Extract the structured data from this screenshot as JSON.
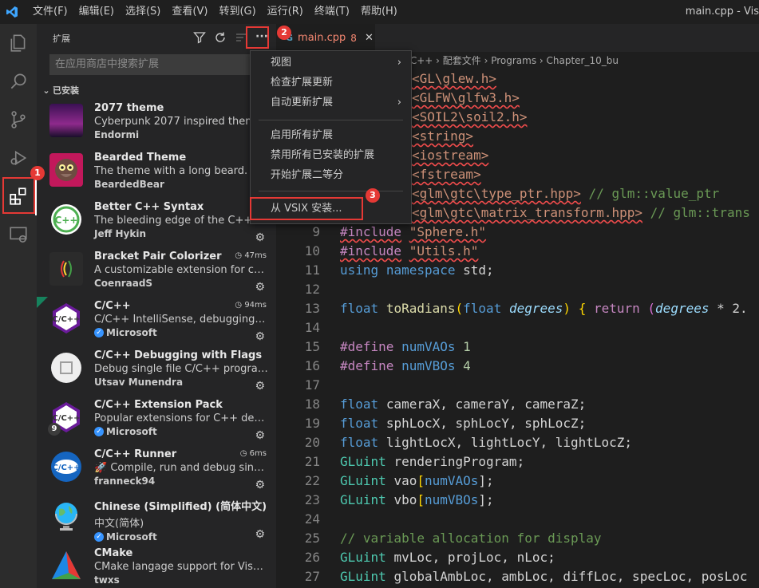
{
  "titlebar": {
    "menus": [
      "文件(F)",
      "编辑(E)",
      "选择(S)",
      "查看(V)",
      "转到(G)",
      "运行(R)",
      "终端(T)",
      "帮助(H)"
    ],
    "window_title": "main.cpp - Vis"
  },
  "sidebar": {
    "title": "扩展",
    "search_placeholder": "在应用商店中搜索扩展",
    "section_label": "已安装",
    "extensions": [
      {
        "name": "2077 theme",
        "desc": "Cyberpunk 2077 inspired theme",
        "publisher": "Endormi",
        "meta": "",
        "verified": false
      },
      {
        "name": "Bearded Theme",
        "desc": "The theme with a long beard.",
        "publisher": "BeardedBear",
        "meta": "",
        "verified": false
      },
      {
        "name": "Better C++ Syntax",
        "desc": "The bleeding edge of the C++ syntax",
        "publisher": "Jeff Hykin",
        "meta": "",
        "verified": false
      },
      {
        "name": "Bracket Pair Colorizer",
        "desc": "A customizable extension for coloriz...",
        "publisher": "CoenraadS",
        "meta": "47ms",
        "verified": false
      },
      {
        "name": "C/C++",
        "desc": "C/C++ IntelliSense, debugging, and...",
        "publisher": "Microsoft",
        "meta": "94ms",
        "verified": true
      },
      {
        "name": "C/C++ Debugging with Flags",
        "desc": "Debug single file C/C++ programs ...",
        "publisher": "Utsav Munendra",
        "meta": "",
        "verified": false
      },
      {
        "name": "C/C++ Extension Pack",
        "desc": "Popular extensions for C++ develop...",
        "publisher": "Microsoft",
        "meta": "",
        "verified": true,
        "count": "9"
      },
      {
        "name": "C/C++ Runner",
        "desc": "🚀 Compile, run and debug single ...",
        "publisher": "franneck94",
        "meta": "6ms",
        "verified": false
      },
      {
        "name": "Chinese (Simplified) (简体中文) La...",
        "desc": "中文(简体)",
        "publisher": "Microsoft",
        "meta": "",
        "verified": true
      },
      {
        "name": "CMake",
        "desc": "CMake langage support for Visual S...",
        "publisher": "twxs",
        "meta": "",
        "verified": false
      }
    ]
  },
  "tab": {
    "label": "main.cpp",
    "problems": "8",
    "close": "✕"
  },
  "breadcrumb": "机图形学编程 使用OpenGL和C++ › 配套文件 › Programs › Chapter_10_bu",
  "menu": {
    "items": [
      "视图",
      "检查扩展更新",
      "自动更新扩展",
      "启用所有扩展",
      "禁用所有已安装的扩展",
      "开始扩展二等分",
      "从 VSIX 安装..."
    ]
  },
  "annotations": [
    "1",
    "2",
    "3"
  ],
  "code": {
    "l1": "<GL\\glew.h>",
    "l2": "<GLFW\\glfw3.h>",
    "l3": "<SOIL2\\soil2.h>",
    "l4": "<string>",
    "l5": "<iostream>",
    "l6": "<fstream>",
    "l7a": "<glm\\gtc\\type_ptr.hpp>",
    "l7b": " // glm::value_ptr",
    "l8a": "<glm\\gtc\\matrix_transform.hpp>",
    "l8b": " // glm::trans",
    "l9a": "#include",
    "l9b": "\"Sphere.h\"",
    "l10a": "#include",
    "l10b": "\"Utils.h\"",
    "l11a": "using",
    "l11b": "namespace",
    "l11c": "std;",
    "l13a": "float",
    "l13b": "toRadians",
    "l13c": "(",
    "l13d": "float",
    "l13e": "degrees",
    "l13f": ")",
    "l13g": "{",
    "l13h": "return",
    "l13i": "(",
    "l13j": "degrees",
    "l13k": "* 2.",
    "l15a": "#define",
    "l15b": "numVAOs",
    "l15c": "1",
    "l16a": "#define",
    "l16b": "numVBOs",
    "l16c": "4",
    "l18a": "float",
    "l18b": "cameraX, cameraY, cameraZ;",
    "l19a": "float",
    "l19b": "sphLocX, sphLocY, sphLocZ;",
    "l20a": "float",
    "l20b": "lightLocX, lightLocY, lightLocZ;",
    "l21a": "GLuint",
    "l21b": "renderingProgram;",
    "l22a": "GLuint",
    "l22b": "vao",
    "l22c": "[",
    "l22d": "numVAOs",
    "l22e": "];",
    "l23a": "GLuint",
    "l23b": "vbo",
    "l23c": "[",
    "l23d": "numVBOs",
    "l23e": "];",
    "l25": "// variable allocation for display",
    "l26a": "GLuint",
    "l26b": "mvLoc, projLoc, nLoc;",
    "l27a": "GLuint",
    "l27b": "globalAmbLoc, ambLoc, diffLoc, specLoc, posLoc"
  },
  "line_numbers": [
    "9",
    "10",
    "11",
    "12",
    "13",
    "14",
    "15",
    "16",
    "17",
    "18",
    "19",
    "20",
    "21",
    "22",
    "23",
    "24",
    "25",
    "26",
    "27"
  ]
}
